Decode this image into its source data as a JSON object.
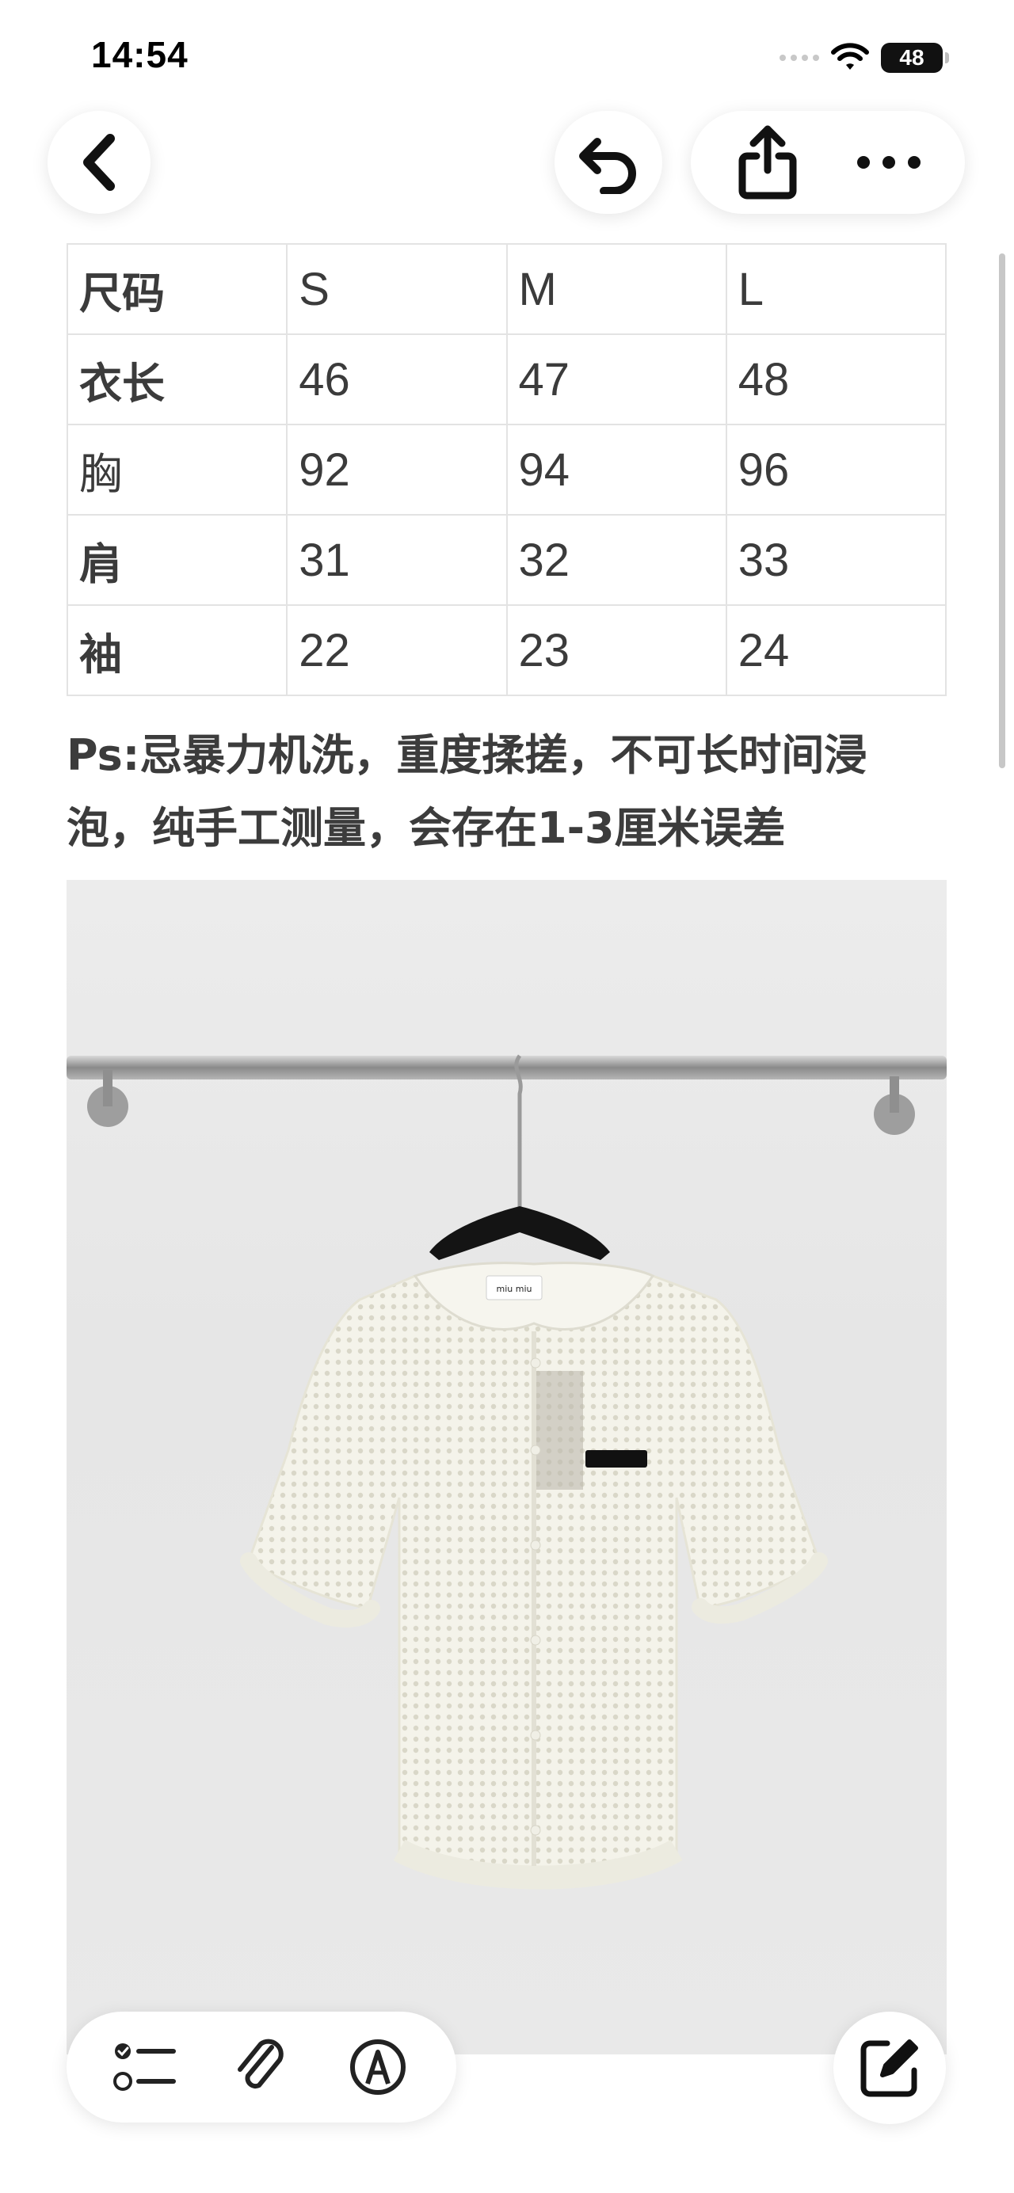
{
  "status_bar": {
    "time": "14:54",
    "battery": "48",
    "icons": [
      "signal-dots-icon",
      "wifi-icon",
      "battery-icon"
    ]
  },
  "nav": {
    "icons": [
      "chevron-left-icon",
      "undo-icon",
      "share-icon",
      "more-icon"
    ]
  },
  "size_table": {
    "header": [
      "尺码",
      "S",
      "M",
      "L"
    ],
    "rows": [
      [
        "衣长",
        "46",
        "47",
        "48"
      ],
      [
        "胸",
        "92",
        "94",
        "96"
      ],
      [
        "肩",
        "31",
        "32",
        "33"
      ],
      [
        "袖",
        "22",
        "23",
        "24"
      ]
    ]
  },
  "note": {
    "line1": "Ps:忌暴力机洗，重度揉搓，不可长时间浸",
    "line2": "泡，纯手工测量，会存在1-3厘米误差"
  },
  "photo": {
    "label_text": "miu miu"
  },
  "bottom_toolbar": {
    "icons": [
      "checklist-icon",
      "paperclip-icon",
      "markup-pen-icon",
      "compose-icon"
    ]
  },
  "colors": {
    "text": "#3a3a3a",
    "border": "#e3e3e3",
    "background": "#ffffff"
  }
}
